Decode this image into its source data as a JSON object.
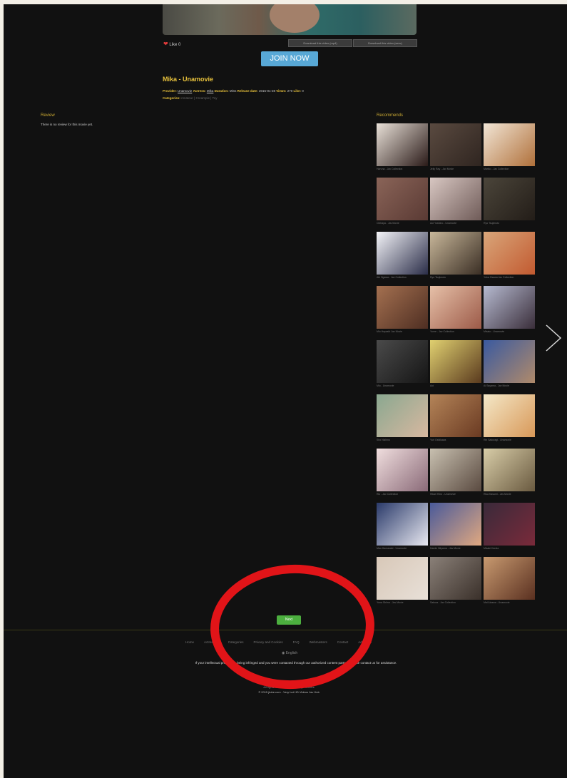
{
  "player": {
    "like_count": "Like 0",
    "download_1": "Download this video (mp4)",
    "download_2": "Download this video (wmv)"
  },
  "cta": {
    "join_label": "JOIN NOW"
  },
  "video": {
    "title": "Mika - Unamovie",
    "meta1": {
      "provider_label": "Provider:",
      "provider": "Unamovie",
      "actress_label": "Actress:",
      "actress": "Mika",
      "duration_label": "Duration:",
      "duration": "Mins",
      "release_label": "Release date:",
      "release": "2015-01-28",
      "views_label": "Views:",
      "views": "270",
      "likes_label": "Like:",
      "likes": "0"
    },
    "meta2": {
      "categories_label": "Categories:",
      "categories": "Amateur | Creampie | Toy"
    }
  },
  "review": {
    "heading": "Review",
    "text": "There is no review for this movie yet."
  },
  "recommends": {
    "heading": "Recommends",
    "items": [
      {
        "caption": "Haruna - Jav Collection",
        "c1": "#e9e1d8",
        "c2": "#2a1a18"
      },
      {
        "caption": "Jelly Ray - Jav Movie",
        "c1": "#5a4a40",
        "c2": "#2f2520"
      },
      {
        "caption": "Mariko - Jav Collection",
        "c1": "#f2e6d6",
        "c2": "#b0703a"
      },
      {
        "caption": "Chihaya - Jav Movie",
        "c1": "#8a6458",
        "c2": "#5a3a34"
      },
      {
        "caption": "Aoi Yoshino - Unamovie",
        "c1": "#d8c7c2",
        "c2": "#6f5b58"
      },
      {
        "caption": "Ryo Tsujimoto",
        "c1": "#4b453a",
        "c2": "#231d18"
      },
      {
        "caption": "Aki Ogawa - Jav Collection",
        "c1": "#f4f4f8",
        "c2": "#2a2d48"
      },
      {
        "caption": "Ryo Tsujimoto",
        "c1": "#c8b79a",
        "c2": "#3a2e24"
      },
      {
        "caption": "Yuka Osawa Jav Collection",
        "c1": "#d9a67a",
        "c2": "#c25a30"
      },
      {
        "caption": "Mio Hayashi Jav Movie",
        "c1": "#a47050",
        "c2": "#4e2e22"
      },
      {
        "caption": "Yume - Jav Collection",
        "c1": "#e6c0a8",
        "c2": "#9c5a48"
      },
      {
        "caption": "Misato - Unamovie",
        "c1": "#b6bad0",
        "c2": "#3a2e3a"
      },
      {
        "caption": "Mio - Unamovie",
        "c1": "#4a4a4a",
        "c2": "#151515"
      },
      {
        "caption": "Aoi",
        "c1": "#e0d070",
        "c2": "#5a3a1e"
      },
      {
        "caption": "Ai Sayama - Jav Movie",
        "c1": "#3a5aa0",
        "c2": "#b08a6a"
      },
      {
        "caption": "Sho Nishino",
        "c1": "#8aa890",
        "c2": "#d8b8a0"
      },
      {
        "caption": "Yuri Oshikawa",
        "c1": "#b48458",
        "c2": "#6a3a22"
      },
      {
        "caption": "Rin Sakuragi - Unamovie",
        "c1": "#f4e8c8",
        "c2": "#d89858"
      },
      {
        "caption": "Rio - Jav Collection",
        "c1": "#f0dede",
        "c2": "#8a6a78"
      },
      {
        "caption": "Hikari Hino - Unamovie",
        "c1": "#c8c0b0",
        "c2": "#5a4a40"
      },
      {
        "caption": "Risa Kasumi - Jav Movie",
        "c1": "#d8cda8",
        "c2": "#6a5a40"
      },
      {
        "caption": "Mao Hamasaki - Unamovie",
        "c1": "#2a3a6a",
        "c2": "#e8e8f0"
      },
      {
        "caption": "Kaede Niiyama - Jav Movie",
        "c1": "#4a5a9a",
        "c2": "#e0a880"
      },
      {
        "caption": "Misaki Honda",
        "c1": "#3a2a3a",
        "c2": "#7a2a3a"
      },
      {
        "caption": "Yuna Shiina - Jav Movie",
        "c1": "#d8c8b8",
        "c2": "#e8e0d8"
      },
      {
        "caption": "Sakura - Jav Collection",
        "c1": "#8a8078",
        "c2": "#3a302a"
      },
      {
        "caption": "Mai Aizawa - Unamovie",
        "c1": "#c89a70",
        "c2": "#5a3020"
      }
    ]
  },
  "pager": {
    "next_label": "Next"
  },
  "footer": {
    "links": [
      "Home",
      "Actresses",
      "Categories",
      "Privacy and Cookies",
      "FAQ",
      "Webmasters",
      "Contact",
      "Advertise"
    ],
    "language": "English",
    "notice": "If your intellectual property is being infringed and you were contacted through our authorized content partner, please contact us for assistance.",
    "copyright": "All rights reserved. Powered by Partners",
    "copyright2": "© 2015 jtube.com - Very hot HD Videos Jav Hub"
  },
  "colors": {
    "accent": "#e8c23c",
    "join": "#58a8d6",
    "next": "#4caf3f",
    "annotation": "#e11418"
  }
}
